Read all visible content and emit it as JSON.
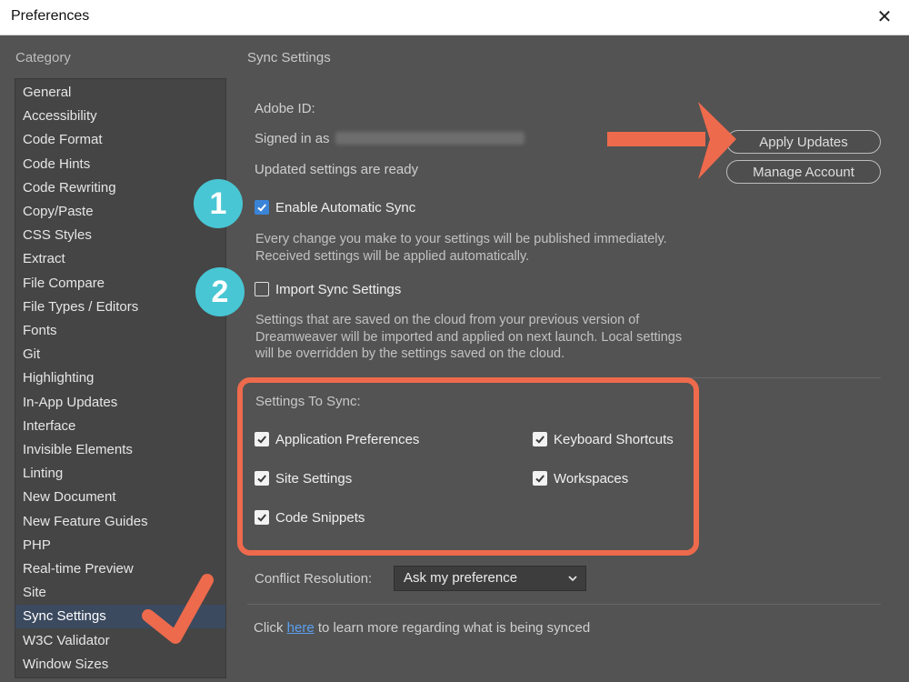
{
  "window": {
    "title": "Preferences",
    "close_icon": "close-icon"
  },
  "category": {
    "heading": "Category",
    "items": [
      {
        "label": "General"
      },
      {
        "label": "Accessibility"
      },
      {
        "label": "Code Format"
      },
      {
        "label": "Code Hints"
      },
      {
        "label": "Code Rewriting"
      },
      {
        "label": "Copy/Paste"
      },
      {
        "label": "CSS Styles"
      },
      {
        "label": "Extract"
      },
      {
        "label": "File Compare"
      },
      {
        "label": "File Types / Editors"
      },
      {
        "label": "Fonts"
      },
      {
        "label": "Git"
      },
      {
        "label": "Highlighting"
      },
      {
        "label": "In-App Updates"
      },
      {
        "label": "Interface"
      },
      {
        "label": "Invisible Elements"
      },
      {
        "label": "Linting"
      },
      {
        "label": "New Document"
      },
      {
        "label": "New Feature Guides"
      },
      {
        "label": "PHP"
      },
      {
        "label": "Real-time Preview"
      },
      {
        "label": "Site"
      },
      {
        "label": "Sync Settings"
      },
      {
        "label": "W3C Validator"
      },
      {
        "label": "Window Sizes"
      }
    ],
    "selected": "Sync Settings"
  },
  "sync": {
    "title": "Sync Settings",
    "adobe_id_label": "Adobe ID:",
    "signed_in_label": "Signed in as",
    "updated_label": "Updated settings are ready",
    "apply_updates": "Apply Updates",
    "manage_account": "Manage Account",
    "enable_auto_sync": {
      "label": "Enable Automatic Sync",
      "checked": true
    },
    "enable_desc": [
      "Every change you make to your settings will be published immediately.",
      "Received settings will be applied automatically."
    ],
    "import_sync": {
      "label": "Import Sync Settings",
      "checked": false
    },
    "import_desc": [
      "Settings that are saved on the cloud from your previous version of",
      "Dreamweaver will be imported and applied on next launch. Local settings",
      "will be overridden by the settings saved on the cloud."
    ],
    "settings_to_sync_heading": "Settings To Sync:",
    "options": {
      "app_prefs": {
        "label": "Application Preferences",
        "checked": true
      },
      "keyboard": {
        "label": "Keyboard Shortcuts",
        "checked": true
      },
      "site_settings": {
        "label": "Site Settings",
        "checked": true
      },
      "workspaces": {
        "label": "Workspaces",
        "checked": true
      },
      "code_snippets": {
        "label": "Code Snippets",
        "checked": true
      }
    },
    "conflict_label": "Conflict Resolution:",
    "conflict_value": "Ask my preference",
    "footer_click": "Click",
    "footer_link": "here",
    "footer_rest": "to learn more regarding what is being synced"
  },
  "annotations": {
    "badge1": "1",
    "badge2": "2",
    "accent_color": "#ee6a4c",
    "badge_color": "#48c6d4"
  }
}
